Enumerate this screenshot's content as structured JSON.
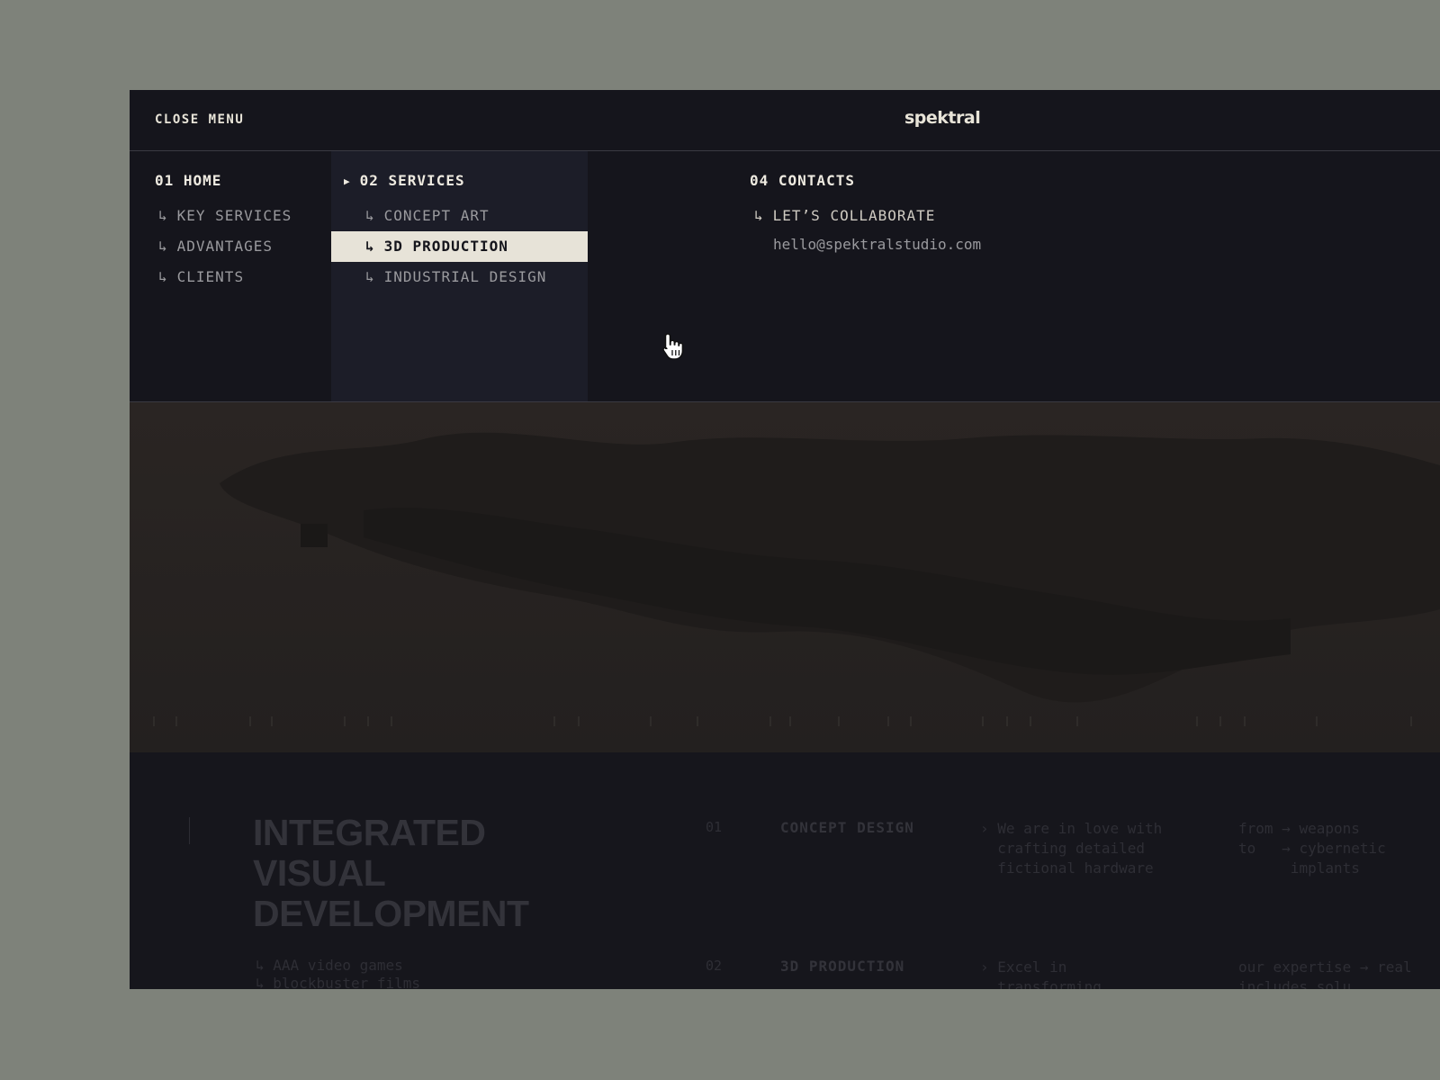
{
  "header": {
    "close_menu": "CLOSE MENU",
    "logo": "spektral"
  },
  "menu": {
    "home": {
      "title": "01 HOME",
      "items": [
        "KEY SERVICES",
        "ADVANTAGES",
        "CLIENTS"
      ]
    },
    "services": {
      "title": "02 SERVICES",
      "items": [
        "CONCEPT ART",
        "3D PRODUCTION",
        "INDUSTRIAL DESIGN"
      ],
      "active_index": 1
    },
    "contacts": {
      "title": "04 CONTACTS",
      "collaborate": "LET’S COLLABORATE",
      "email": "hello@spektralstudio.com"
    },
    "arrow_glyph": "↳",
    "active_marker": "▶"
  },
  "lower": {
    "title_lines": [
      "INTEGRATED",
      "VISUAL",
      "DEVELOPMENT"
    ],
    "list": [
      "AAA video games",
      "blockbuster films"
    ],
    "services": [
      {
        "num": "01",
        "name": "CONCEPT DESIGN",
        "desc": [
          "We are in love with",
          "crafting detailed",
          "fictional hardware"
        ],
        "meta_left": [
          "from",
          "to"
        ],
        "meta_right": [
          "→ weapons",
          "→ cybernetic",
          "  implants"
        ]
      },
      {
        "num": "02",
        "name": "3D PRODUCTION",
        "desc": [
          "Excel in",
          "transforming"
        ],
        "meta_left": [
          "our expertise",
          "includes"
        ],
        "meta_right": [
          "→ real",
          "  solu"
        ]
      }
    ]
  },
  "colors": {
    "background": "#7e827a",
    "panel": "#15151c",
    "services_column": "#1c1d28",
    "active_item": "#e7e3d8",
    "text_primary": "#eeeae0",
    "text_muted": "#9a9a9e"
  },
  "icons": {
    "cursor": "hand-pointer-icon",
    "sub_arrow": "return-arrow-icon"
  }
}
